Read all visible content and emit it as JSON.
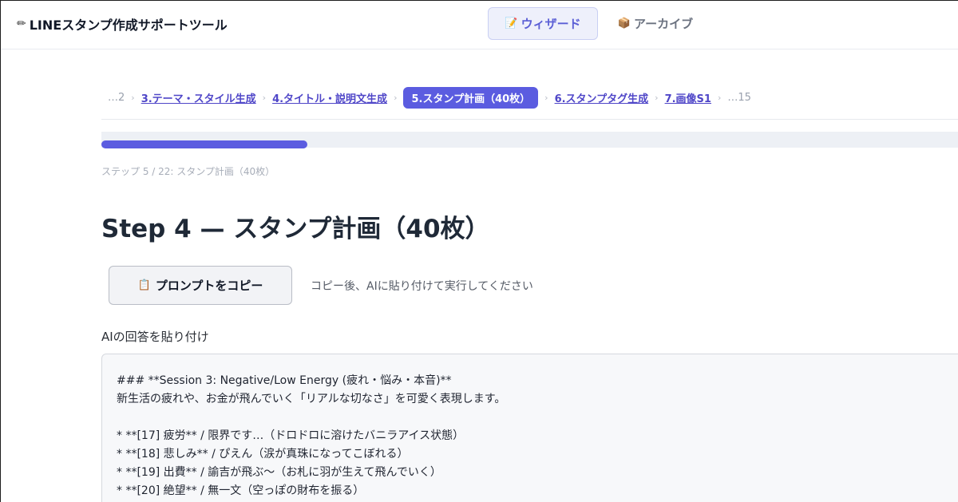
{
  "header": {
    "app_title": "LINEスタンプ作成サポートツール",
    "nav": {
      "wizard_label": "ウィザード",
      "archive_label": "アーカイブ"
    }
  },
  "breadcrumb": {
    "items": [
      {
        "label": "…2"
      },
      {
        "label": "3.テーマ・スタイル生成"
      },
      {
        "label": "4.タイトル・説明文生成"
      },
      {
        "label": "5.スタンプ計画（40枚）"
      },
      {
        "label": "6.スタンプタグ生成"
      },
      {
        "label": "7.画像S1"
      },
      {
        "label": "…15"
      }
    ]
  },
  "progress": {
    "current_step": 5,
    "total_steps": 22,
    "label": "ステップ 5 / 22: スタンプ計画（40枚）"
  },
  "main": {
    "title": "Step 4 — スタンプ計画（40枚）",
    "copy_button_label": "プロンプトをコピー",
    "copy_hint": "コピー後、AIに貼り付けて実行してください",
    "paste_label": "AIの回答を貼り付け",
    "answer_lines": [
      "### **Session 3: Negative/Low Energy (疲れ・悩み・本音)**",
      "新生活の疲れや、お金が飛んでいく「リアルな切なさ」を可愛く表現します。",
      "",
      "* **[17] 疲労** / 限界です…（ドロドロに溶けたバニラアイス状態）",
      "* **[18] 悲しみ** / ぴえん（涙が真珠になってこぼれる）",
      "* **[19] 出費** / 諭吉が飛ぶ〜（お札に羽が生えて飛んでいく）",
      "* **[20] 絶望** / 無一文（空っぽの財布を振る）"
    ]
  },
  "colors": {
    "accent": "#5b5ce0",
    "link": "#4f46c8",
    "progress_track": "#edf0f5"
  },
  "icons": {
    "app": "pencil-icon",
    "wizard": "memo-icon",
    "archive": "package-icon",
    "copy": "clipboard-icon"
  }
}
